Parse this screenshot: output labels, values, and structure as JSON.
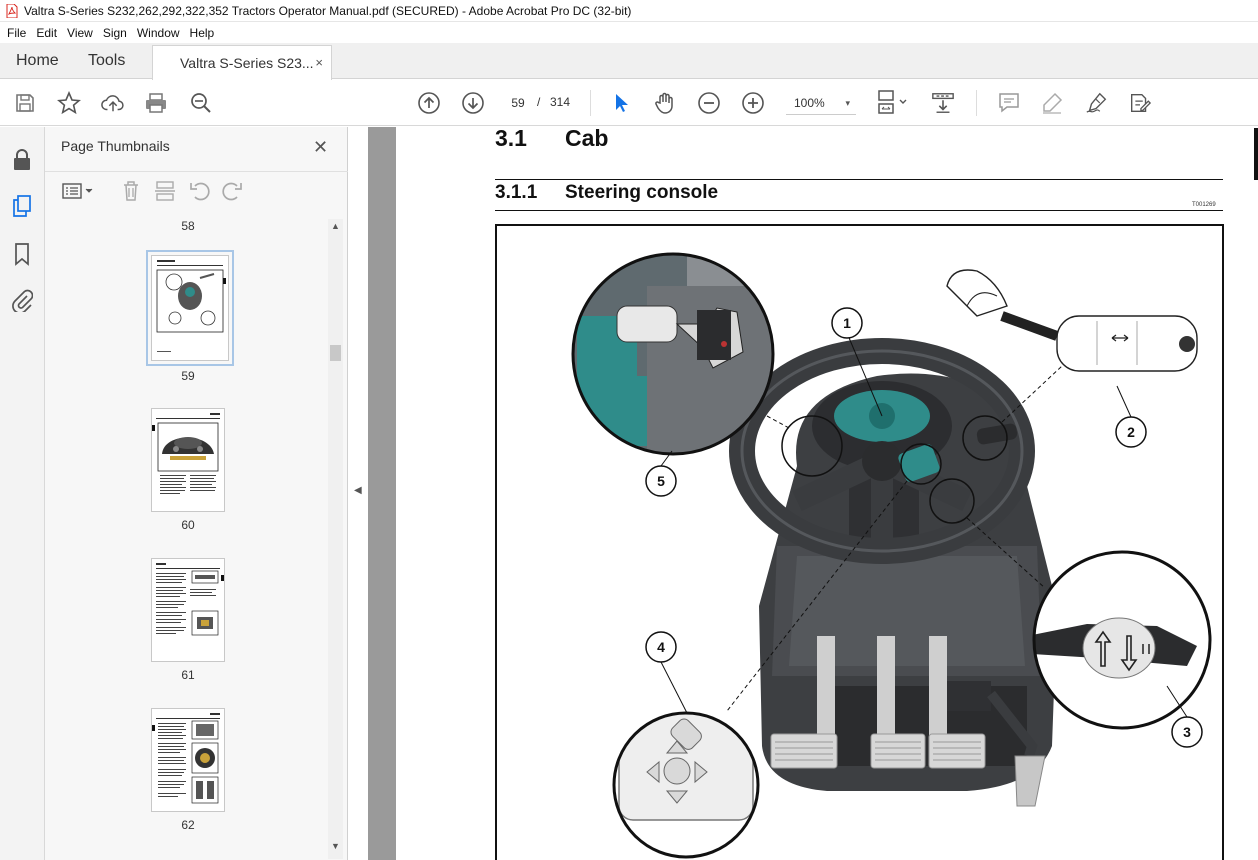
{
  "window": {
    "title": "Valtra S-Series S232,262,292,322,352 Tractors Operator Manual.pdf (SECURED) - Adobe Acrobat Pro DC (32-bit)"
  },
  "menu": [
    "File",
    "Edit",
    "View",
    "Sign",
    "Window",
    "Help"
  ],
  "tabs": {
    "home": "Home",
    "tools": "Tools",
    "document": "Valtra S-Series S23...",
    "close_glyph": "×"
  },
  "toolbar": {
    "current_page": "59",
    "page_separator": "/",
    "total_pages": "314",
    "zoom": "100%",
    "zoom_caret": "▾"
  },
  "thumbnails": {
    "title": "Page Thumbnails",
    "close_glyph": "✕",
    "pages": [
      {
        "label": "58"
      },
      {
        "label": "59",
        "selected": true
      },
      {
        "label": "60"
      },
      {
        "label": "61"
      },
      {
        "label": "62"
      }
    ]
  },
  "document": {
    "section_number": "3.1",
    "section_title": "Cab",
    "subsection_number": "3.1.1",
    "subsection_title": "Steering console",
    "figure_code": "T001269",
    "callouts": [
      "1",
      "2",
      "3",
      "4",
      "5"
    ]
  },
  "colors": {
    "acrobat_red": "#d9241c",
    "selection_blue": "#1473e6",
    "panel_bg": "#f7f7f7",
    "doc_bg": "#9a9a9a",
    "teal_display": "#2f8c8a"
  }
}
